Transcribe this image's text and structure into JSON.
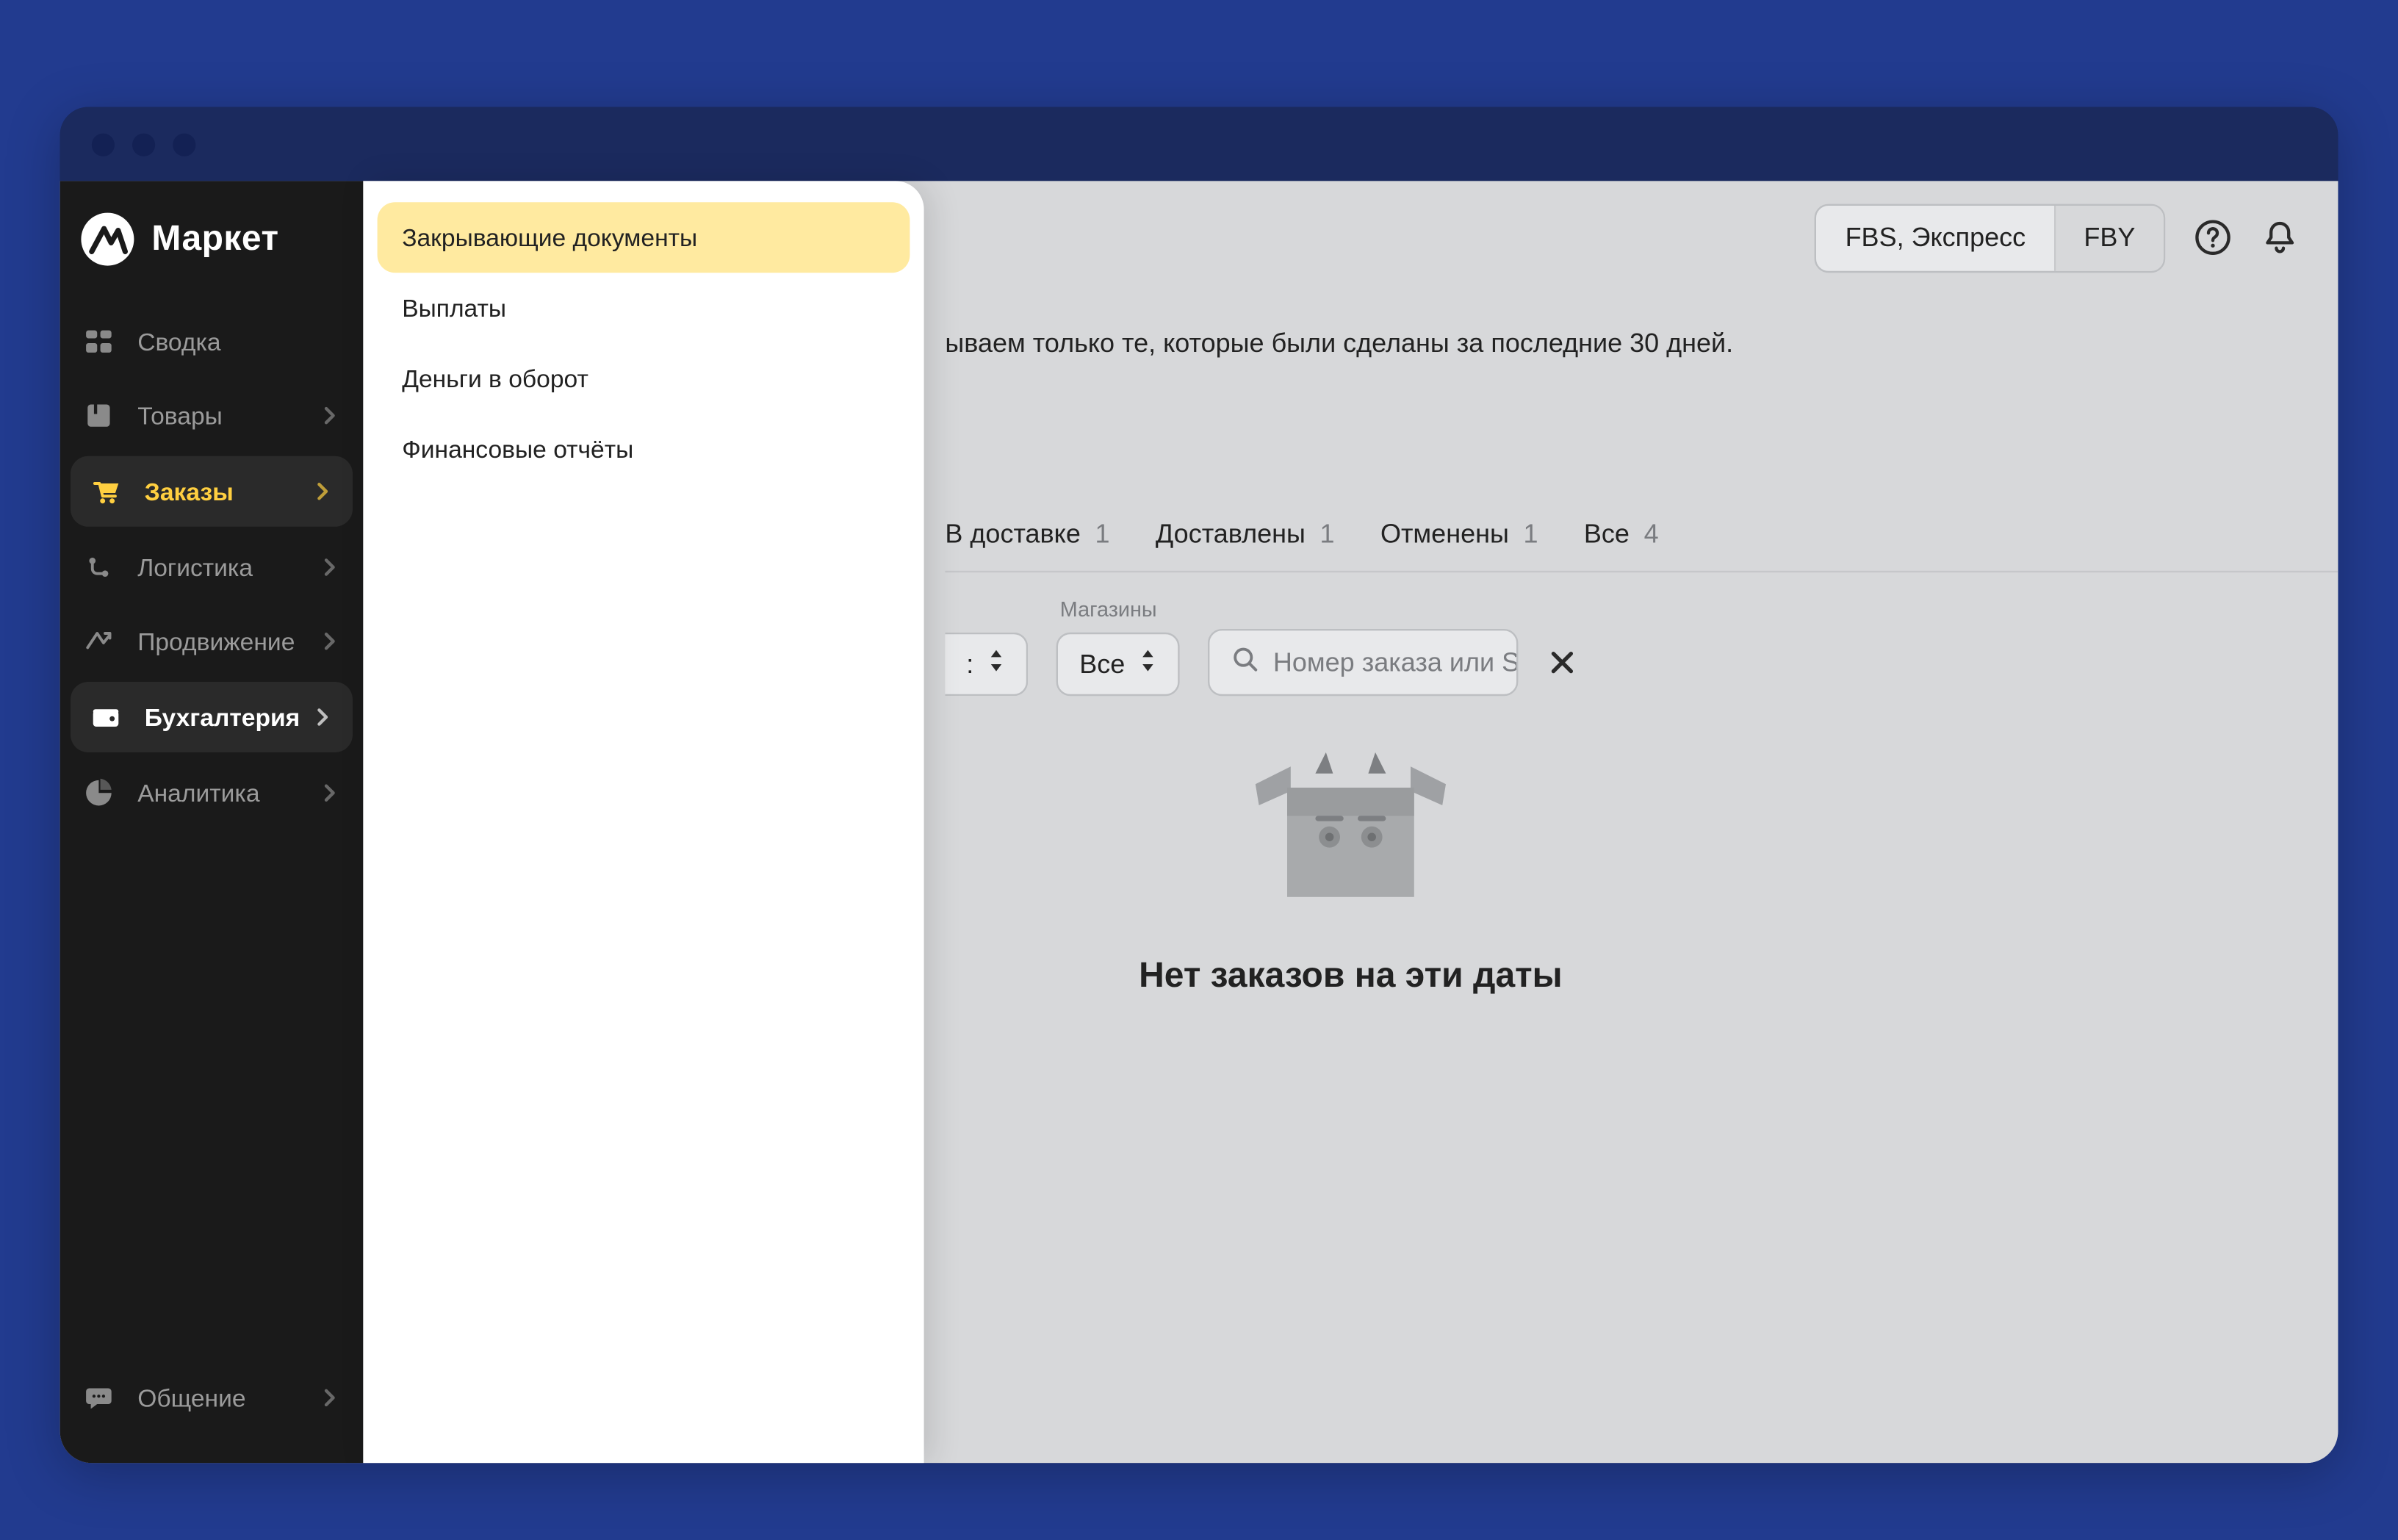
{
  "brand": {
    "name": "Маркет"
  },
  "sidebar": {
    "items": [
      {
        "label": "Сводка",
        "icon": "dashboard-icon",
        "chevron": false
      },
      {
        "label": "Товары",
        "icon": "products-icon",
        "chevron": true
      },
      {
        "label": "Заказы",
        "icon": "orders-icon",
        "chevron": true
      },
      {
        "label": "Логистика",
        "icon": "logistics-icon",
        "chevron": true
      },
      {
        "label": "Продвижение",
        "icon": "promotion-icon",
        "chevron": true
      },
      {
        "label": "Бухгалтерия",
        "icon": "accounting-icon",
        "chevron": true
      },
      {
        "label": "Аналитика",
        "icon": "analytics-icon",
        "chevron": true
      }
    ],
    "footer": {
      "label": "Общение",
      "icon": "chat-icon",
      "chevron": true
    }
  },
  "submenu": {
    "items": [
      {
        "label": "Закрывающие документы",
        "active": true
      },
      {
        "label": "Выплаты",
        "active": false
      },
      {
        "label": "Деньги в оборот",
        "active": false
      },
      {
        "label": "Финансовые отчёты",
        "active": false
      }
    ]
  },
  "header": {
    "models": [
      {
        "label": "FBS, Экспресс"
      },
      {
        "label": "FBY"
      }
    ]
  },
  "hint": "ываем только те, которые были сделаны за последние 30 дней.",
  "tabs": [
    {
      "label": "В доставке",
      "count": "1"
    },
    {
      "label": "Доставлены",
      "count": "1"
    },
    {
      "label": "Отменены",
      "count": "1"
    },
    {
      "label": "Все",
      "count": "4"
    }
  ],
  "filters": {
    "partial_select_suffix": ":",
    "stores_label": "Магазины",
    "stores_value": "Все",
    "search_placeholder": "Номер заказа или SKU"
  },
  "empty": {
    "title": "Нет заказов на эти даты"
  }
}
